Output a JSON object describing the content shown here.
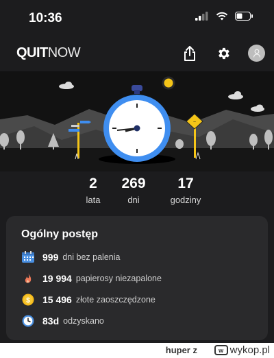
{
  "status_bar": {
    "time": "10:36"
  },
  "header": {
    "logo_bold": "QUIT",
    "logo_light": "NOW",
    "icons": [
      "share-icon",
      "gear-icon",
      "avatar-icon"
    ]
  },
  "stats": [
    {
      "value": "2",
      "label": "lata"
    },
    {
      "value": "269",
      "label": "dni"
    },
    {
      "value": "17",
      "label": "godziny"
    }
  ],
  "progress": {
    "title": "Ogólny postęp",
    "rows": [
      {
        "icon": "calendar-icon",
        "value": "999",
        "text": "dni bez palenia"
      },
      {
        "icon": "flame-icon",
        "value": "19 994",
        "text": "papierosy niezapalone"
      },
      {
        "icon": "coin-icon",
        "value": "15 496",
        "text": "złote zaoszczędzone"
      },
      {
        "icon": "clock-icon",
        "value": "83d",
        "text": "odzyskano"
      }
    ]
  },
  "footer": {
    "user": "huper",
    "suffix": "z",
    "brand": "wykop.pl"
  },
  "colors": {
    "accent_blue": "#3f8ef0",
    "clock_face": "#ffffff",
    "sun": "#f5c518",
    "calendar": "#4a90e2",
    "coin": "#f5b919"
  }
}
